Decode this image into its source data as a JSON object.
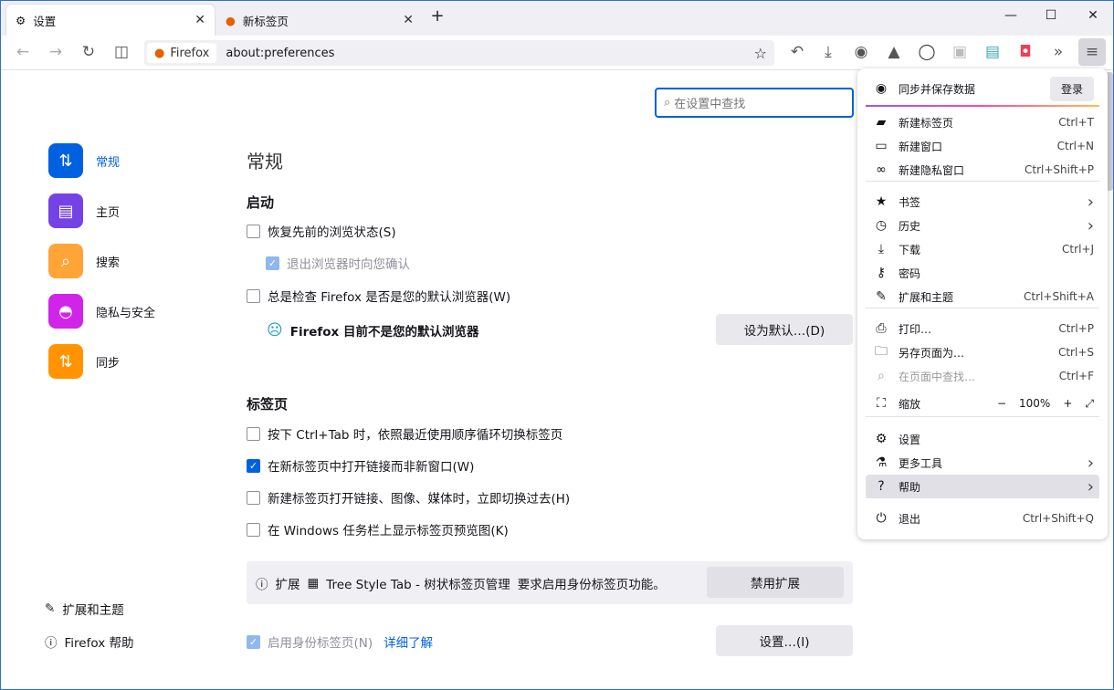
{
  "tabs": [
    {
      "title": "设置",
      "active": true
    },
    {
      "title": "新标签页",
      "active": false
    }
  ],
  "window": {
    "minimize": "—",
    "maximize": "☐",
    "close": "✕",
    "new_tab": "+"
  },
  "urlbar": {
    "identity": "Firefox",
    "url": "about:preferences"
  },
  "search": {
    "placeholder": "在设置中查找"
  },
  "sidebar": {
    "items": [
      {
        "label": "常规",
        "color": "#0061e0",
        "icon": "general-icon",
        "active": true
      },
      {
        "label": "主页",
        "color": "#7542e5",
        "icon": "home-icon"
      },
      {
        "label": "搜索",
        "color": "#ffa436",
        "icon": "search-icon"
      },
      {
        "label": "隐私与安全",
        "color": "#d025e8",
        "icon": "privacy-mask-icon"
      },
      {
        "label": "同步",
        "color": "#ff9400",
        "icon": "sync-icon"
      }
    ],
    "footer": [
      "扩展和主题",
      "Firefox 帮助"
    ]
  },
  "main": {
    "title": "常规",
    "startup": {
      "heading": "启动",
      "restore": "恢复先前的浏览状态(S)",
      "confirm_exit": "退出浏览器时向您确认",
      "check_default": "总是检查 Firefox 是否是您的默认浏览器(W)",
      "not_default": "Firefox 目前不是您的默认浏览器",
      "set_default": "设为默认…(D)"
    },
    "tabs": {
      "heading": "标签页",
      "ctrl_tab": "按下 Ctrl+Tab 时，依照最近使用顺序循环切换标签页",
      "open_links": "在新标签页中打开链接而非新窗口(W)",
      "switch_to": "新建标签页打开链接、图像、媒体时，立即切换过去(H)",
      "taskbar": "在 Windows 任务栏上显示标签页预览图(K)"
    },
    "ext_notice": {
      "prefix": "扩展",
      "name": "Tree Style Tab - 树状标签页管理",
      "text": "要求启用身份标签页功能。",
      "button": "禁用扩展"
    },
    "containers": {
      "label": "启用身份标签页(N)",
      "link": "详细了解",
      "button": "设置…(I)"
    }
  },
  "menu": {
    "sync": "同步并保存数据",
    "signin": "登录",
    "zoom_label": "缩放",
    "zoom_value": "100%",
    "groups": [
      [
        {
          "label": "新建标签页",
          "key": "Ctrl+T",
          "icon": "▰"
        },
        {
          "label": "新建窗口",
          "key": "Ctrl+N",
          "icon": "▭"
        },
        {
          "label": "新建隐私窗口",
          "key": "Ctrl+Shift+P",
          "icon": "∞"
        }
      ],
      [
        {
          "label": "书签",
          "key": "›",
          "icon": "★"
        },
        {
          "label": "历史",
          "key": "›",
          "icon": "◷"
        },
        {
          "label": "下载",
          "key": "Ctrl+J",
          "icon": "⤓"
        },
        {
          "label": "密码",
          "key": "",
          "icon": "⚷"
        },
        {
          "label": "扩展和主题",
          "key": "Ctrl+Shift+A",
          "icon": "✎"
        }
      ],
      [
        {
          "label": "打印…",
          "key": "Ctrl+P",
          "icon": "⎙"
        },
        {
          "label": "另存页面为…",
          "key": "Ctrl+S",
          "icon": "🗀"
        },
        {
          "label": "在页面中查找…",
          "key": "Ctrl+F",
          "icon": "⌕"
        }
      ],
      [
        {
          "label": "设置",
          "key": "",
          "icon": "⚙"
        },
        {
          "label": "更多工具",
          "key": "›",
          "icon": "⚗"
        },
        {
          "label": "帮助",
          "key": "›",
          "icon": "?"
        }
      ],
      [
        {
          "label": "退出",
          "key": "Ctrl+Shift+Q",
          "icon": "⏻"
        }
      ]
    ]
  }
}
